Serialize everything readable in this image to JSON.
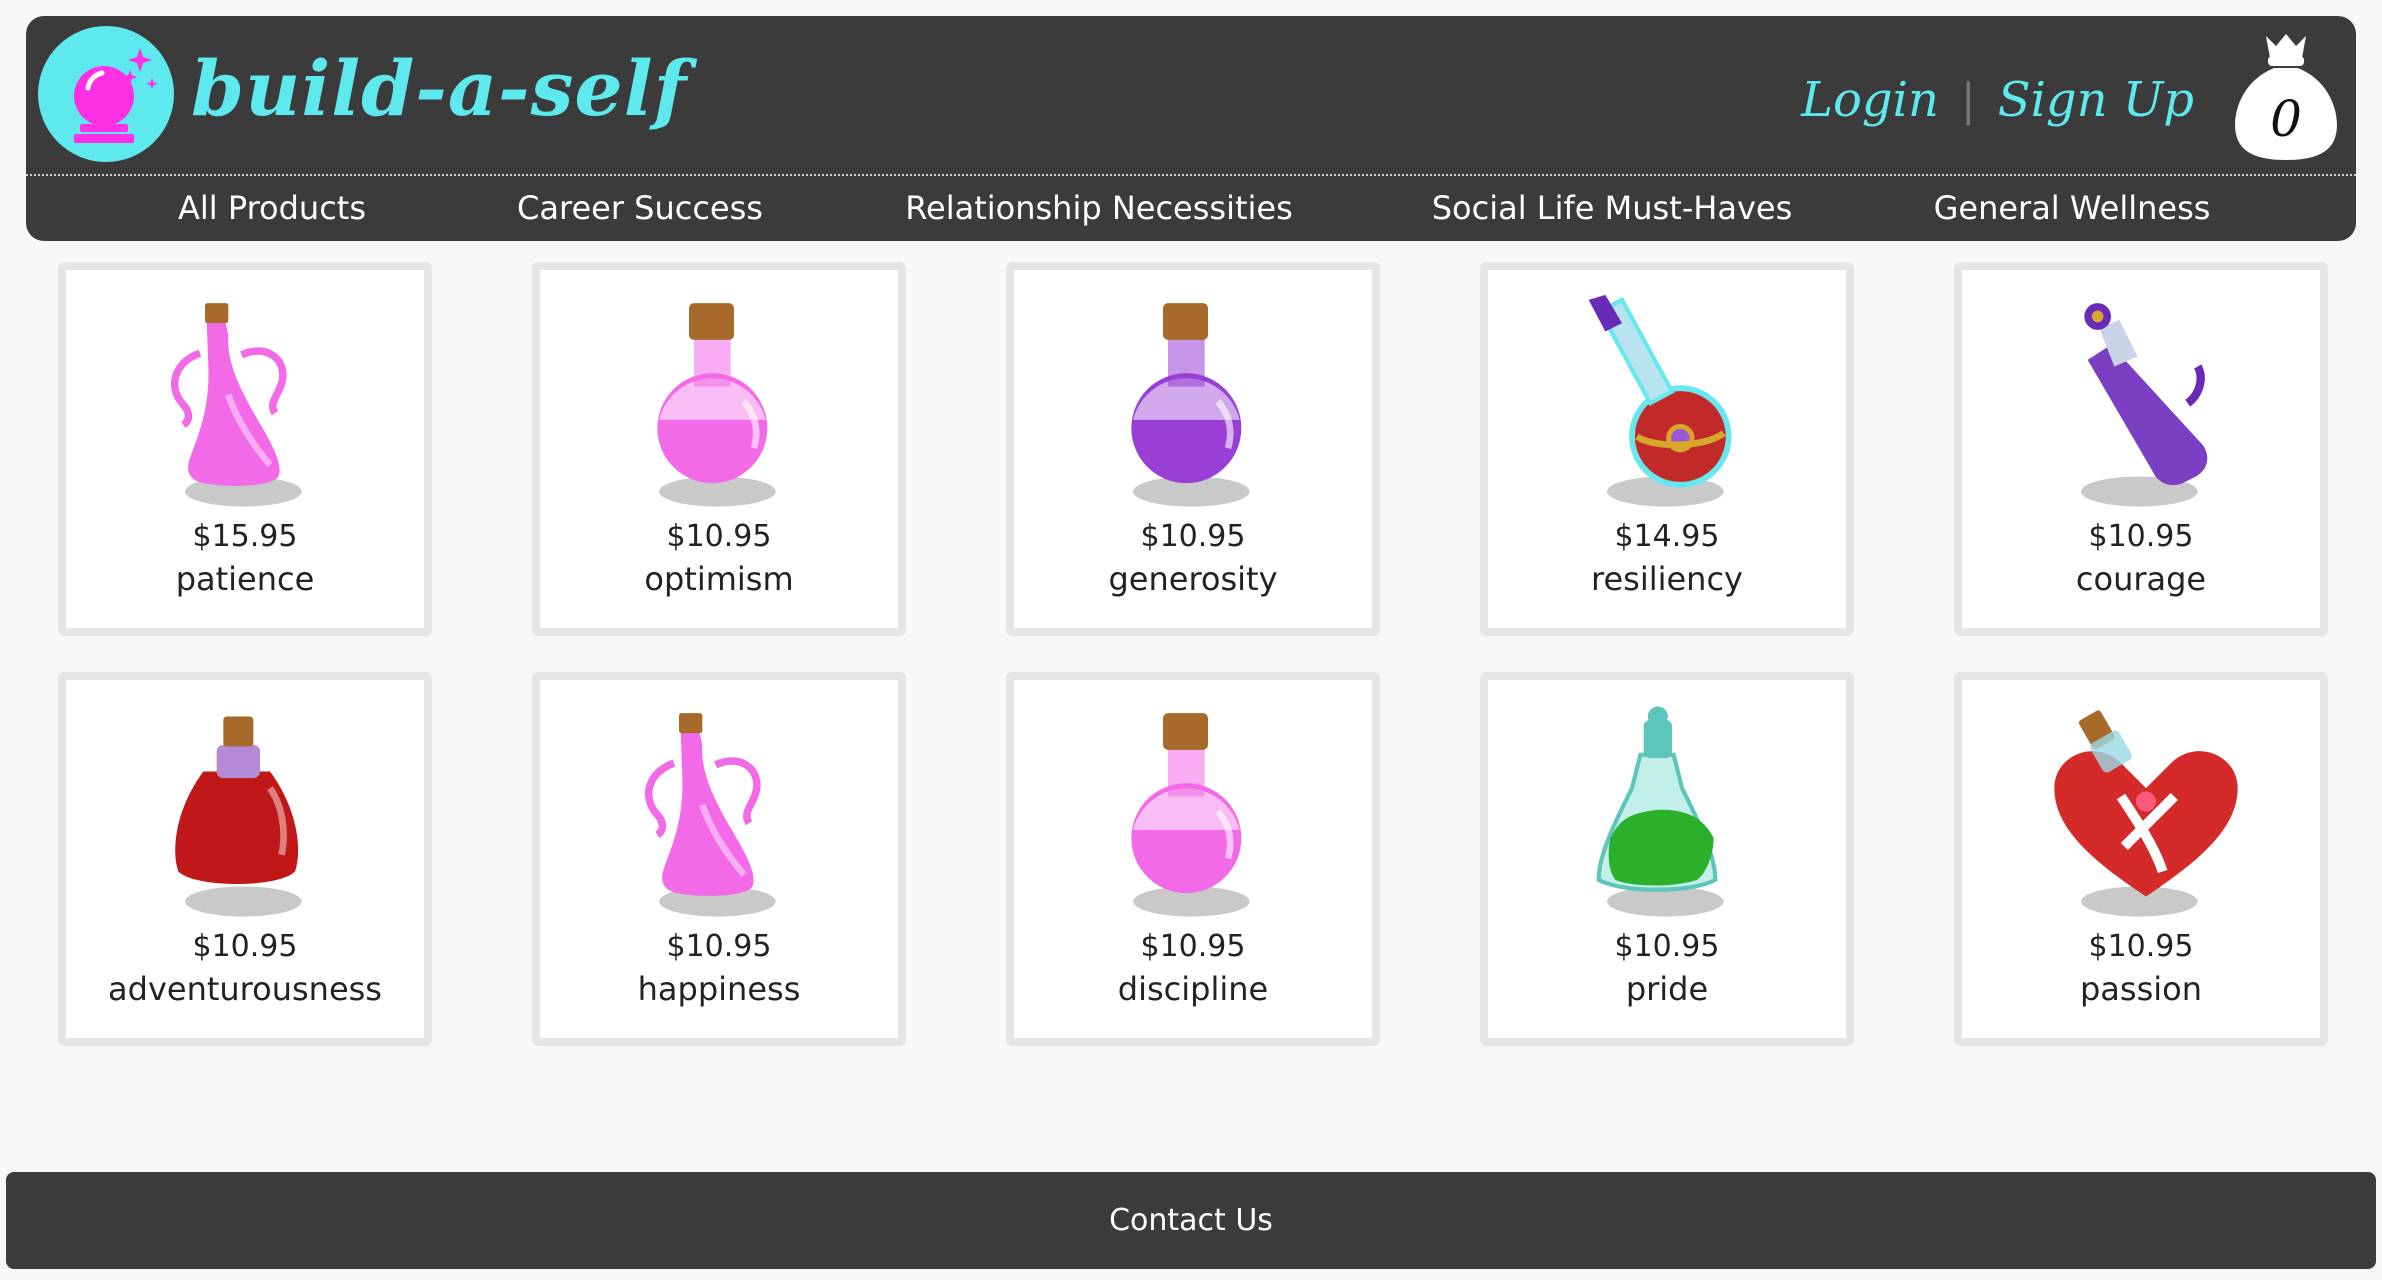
{
  "brand": {
    "name": "build-a-self"
  },
  "auth": {
    "login": "Login",
    "separator": "|",
    "signup": "Sign Up"
  },
  "cart": {
    "count": "0"
  },
  "nav": {
    "items": [
      "All Products",
      "Career Success",
      "Relationship Necessities",
      "Social Life Must-Haves",
      "General Wellness"
    ]
  },
  "products": [
    {
      "price": "$15.95",
      "name": "patience",
      "icon": "pink-carafe-potion-icon",
      "color": "#f26ae8"
    },
    {
      "price": "$10.95",
      "name": "optimism",
      "icon": "pink-round-flask-icon",
      "color": "#f26ae8"
    },
    {
      "price": "$10.95",
      "name": "generosity",
      "icon": "purple-round-flask-icon",
      "color": "#9a3fd6"
    },
    {
      "price": "$14.95",
      "name": "resiliency",
      "icon": "red-ornate-flask-icon",
      "color": "#c22a2a"
    },
    {
      "price": "$10.95",
      "name": "courage",
      "icon": "purple-tube-potion-icon",
      "color": "#7a3fc2"
    },
    {
      "price": "$10.95",
      "name": "adventurousness",
      "icon": "red-squat-bottle-icon",
      "color": "#c01818"
    },
    {
      "price": "$10.95",
      "name": "happiness",
      "icon": "pink-carafe-potion-icon",
      "color": "#f26ae8"
    },
    {
      "price": "$10.95",
      "name": "discipline",
      "icon": "pink-round-flask-icon",
      "color": "#f26ae8"
    },
    {
      "price": "$10.95",
      "name": "pride",
      "icon": "green-cone-bottle-icon",
      "color": "#2bb02b"
    },
    {
      "price": "$10.95",
      "name": "passion",
      "icon": "red-heart-bottle-icon",
      "color": "#d42a2a"
    }
  ],
  "footer": {
    "contact": "Contact Us"
  },
  "colors": {
    "accent": "#5ee9ee",
    "header_bg": "#3b3b3b",
    "logo_orb": "#ff2fe6"
  }
}
